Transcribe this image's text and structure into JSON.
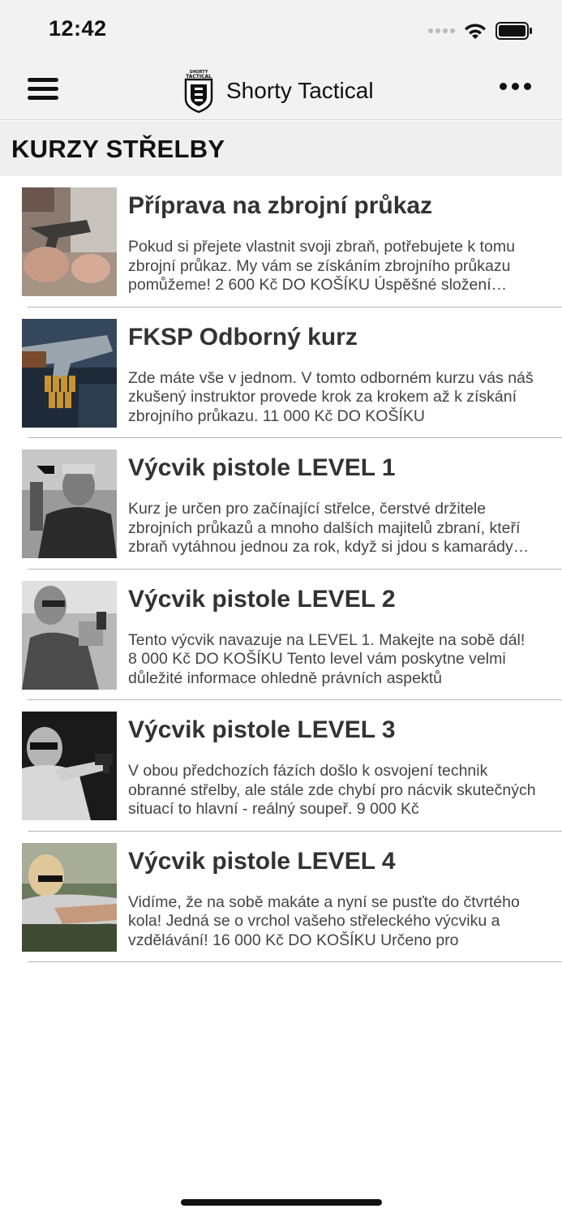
{
  "status_bar": {
    "time": "12:42",
    "icons": [
      "signal-icon",
      "wifi-icon",
      "battery-icon"
    ]
  },
  "nav": {
    "menu_icon": "hamburger-menu-icon",
    "logo": "shorty-tactical-logo",
    "logo_text_top": "SHORTY",
    "logo_text_mid": "TACTICAL",
    "title": "Shorty Tactical",
    "more_icon": "more-dots-icon"
  },
  "section": {
    "title": "KURZY STŘELBY"
  },
  "courses": [
    {
      "title": "Příprava na zbrojní průkaz",
      "description": "Pokud si přejete vlastnit svoji zbraň, potřebujete k tomu zbrojní průkaz.  My vám se získáním zbrojního průkazu pomůžeme!  2 600 Kč  DO KOŠÍKU     Úspěšné složení zkoušky",
      "thumb": "pistol-hands-photo"
    },
    {
      "title": "FKSP Odborný kurz",
      "description": "Zde máte vše v jednom. V tomto odborném kurzu vás náš zkušený instruktor provede krok za krokem až k získání zbrojního průkazu.  11 000 Kč  DO KOŠÍKU",
      "thumb": "pistol-ammo-photo"
    },
    {
      "title": "Výcvik pistole LEVEL 1",
      "description": "Kurz je určen pro začínající střelce, čerstvé držitele zbrojních průkazů a mnoho dalších majitelů zbraní, kteří zbraň vytáhnou jednou za rok, když si jdou s kamarády zastřílet",
      "thumb": "instructor-photo"
    },
    {
      "title": "Výcvik pistole LEVEL 2",
      "description": "Tento výcvik navazuje na LEVEL 1. Makejte na sobě dál!  8 000 Kč  DO KOŠÍKU      Tento level vám poskytne velmi důležité informace ohledně právních aspektů",
      "thumb": "shooter-woman-photo"
    },
    {
      "title": "Výcvik pistole LEVEL 3",
      "description": "V obou předchozích fázích došlo k osvojení technik obranné střelby, ale stále zde chybí pro nácvik skutečných situací to hlavní - reálný soupeř.  9 000 Kč",
      "thumb": "shooter-aiming-photo"
    },
    {
      "title": "Výcvik pistole LEVEL 4",
      "description": "Vidíme, že na sobě makáte a nyní se pusťte do čtvrtého kola!  Jedná se o vrchol vašeho střeleckého výcviku a vzdělávání!  16 000 Kč  DO KOŠÍKU      Určeno pro",
      "thumb": "shooter-range-photo"
    }
  ]
}
